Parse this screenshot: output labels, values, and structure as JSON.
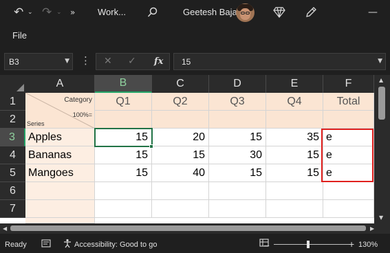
{
  "titlebar": {
    "workbook_name": "Work...",
    "user_name": "Geetesh Bajaj",
    "icons": [
      "undo-icon",
      "chevron-down-icon",
      "redo-icon",
      "chevron-down-icon",
      "search-icon",
      "diamond-icon",
      "pen-icon",
      "minimize-icon"
    ]
  },
  "menubar": {
    "file_label": "File"
  },
  "formula_bar": {
    "name_box_value": "B3",
    "fx_label": "fx",
    "formula_value": "15"
  },
  "sheet": {
    "columns": [
      "A",
      "B",
      "C",
      "D",
      "E",
      "F"
    ],
    "rows": [
      "1",
      "2",
      "3",
      "4",
      "5",
      "6",
      "7"
    ],
    "selected_column": "B",
    "selected_row": "3",
    "a1_category": "Category",
    "a1_percent": "100%=",
    "a1_series": "Series",
    "header_row": [
      "Q1",
      "Q2",
      "Q3",
      "Q4",
      "Total"
    ],
    "data_rows": [
      {
        "label": "Apples",
        "values": [
          "15",
          "20",
          "15",
          "35"
        ],
        "total": "e"
      },
      {
        "label": "Bananas",
        "values": [
          "15",
          "15",
          "30",
          "15"
        ],
        "total": "e"
      },
      {
        "label": "Mangoes",
        "values": [
          "15",
          "40",
          "15",
          "15"
        ],
        "total": "e"
      }
    ]
  },
  "statusbar": {
    "ready": "Ready",
    "accessibility": "Accessibility: Good to go",
    "zoom": "130%"
  },
  "colors": {
    "accent_green": "#217346",
    "highlight_red": "#e0201e",
    "header_band": "#fbe5d3"
  }
}
